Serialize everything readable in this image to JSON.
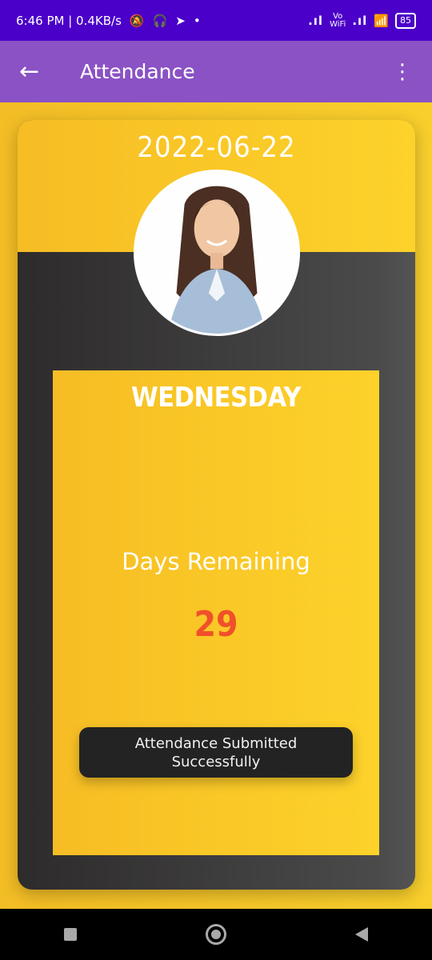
{
  "status_bar": {
    "time_speed": "6:46 PM | 0.4KB/s",
    "icons_left": [
      "muted-bell-icon",
      "headphones-icon",
      "telegram-icon",
      "dot-icon"
    ],
    "vo_label": "Vo",
    "wifi_label": "WiFi",
    "battery": "85"
  },
  "app_bar": {
    "title": "Attendance",
    "back_icon": "arrow-left-icon",
    "menu_icon": "more-vert-icon"
  },
  "card": {
    "date": "2022-06-22",
    "day": "WEDNESDAY",
    "days_remaining_label": "Days Remaining",
    "days_remaining_value": "29"
  },
  "toast": {
    "message": "Attendance Submitted Successfully"
  },
  "nav_bar": {
    "icons": [
      "recents-square-icon",
      "home-circle-icon",
      "back-triangle-icon"
    ]
  },
  "colors": {
    "status_bar": "#4b00c9",
    "app_bar": "#8a52c4",
    "accent_yellow": "#f8c929",
    "card_dark": "#3a393a",
    "days_value": "#f0502a"
  }
}
